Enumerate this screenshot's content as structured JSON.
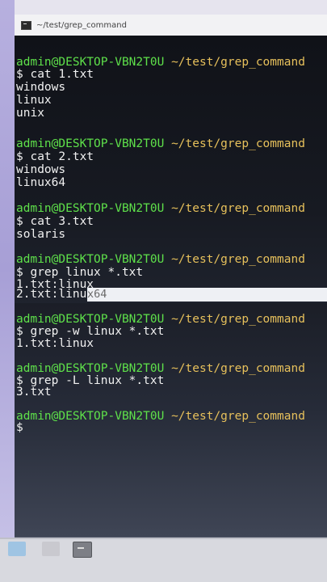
{
  "window": {
    "title": "~/test/grep_command"
  },
  "prompt": {
    "user": "admin@DESKTOP-VBN2T0U",
    "path": "~/test/grep_command"
  },
  "lines": {
    "cmd1": "$ cat 1.txt",
    "out1a": "windows",
    "out1b": "linux",
    "out1c": "unix",
    "cmd2": "$ cat 2.txt",
    "out2a": "windows",
    "out2b": "linux64",
    "cmd3": "$ cat 3.txt",
    "out3a": "solaris",
    "cmd4": "$ grep linux *.txt",
    "out4a": "1.txt:linux",
    "out4b": "2.txt:linu",
    "out4b_hl": "x64",
    "cmd5": "$ grep -w linux *.txt",
    "out5a": "1.txt:linux",
    "cmd6": "$ grep -L linux *.txt",
    "out6a": "3.txt",
    "cmd7": "$"
  },
  "taskbar": {
    "icons": [
      "start-icon",
      "file-explorer-icon",
      "terminal-icon"
    ]
  }
}
